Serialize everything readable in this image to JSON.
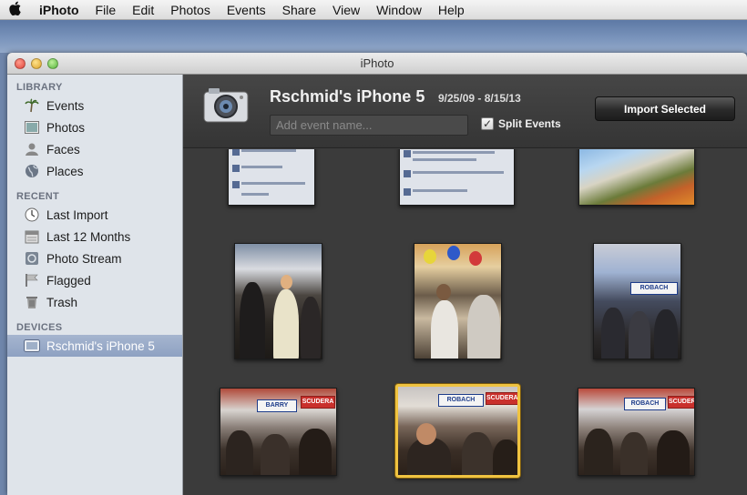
{
  "menubar": {
    "apple_icon": "apple-logo-icon",
    "items": [
      "iPhoto",
      "File",
      "Edit",
      "Photos",
      "Events",
      "Share",
      "View",
      "Window",
      "Help"
    ]
  },
  "window": {
    "title": "iPhoto"
  },
  "sidebar": {
    "library_header": "LIBRARY",
    "library": [
      {
        "label": "Events",
        "icon": "palm-tree-icon"
      },
      {
        "label": "Photos",
        "icon": "photo-icon"
      },
      {
        "label": "Faces",
        "icon": "face-silhouette-icon"
      },
      {
        "label": "Places",
        "icon": "globe-icon"
      }
    ],
    "recent_header": "RECENT",
    "recent": [
      {
        "label": "Last Import",
        "icon": "clock-icon"
      },
      {
        "label": "Last 12 Months",
        "icon": "calendar-icon"
      },
      {
        "label": "Photo Stream",
        "icon": "photo-stream-icon"
      },
      {
        "label": "Flagged",
        "icon": "flag-icon"
      },
      {
        "label": "Trash",
        "icon": "trash-icon"
      }
    ],
    "devices_header": "DEVICES",
    "devices": [
      {
        "label": "Rschmid's iPhone 5",
        "icon": "iphone-device-icon",
        "selected": true
      }
    ]
  },
  "import_header": {
    "device_name": "Rschmid's iPhone 5",
    "date_range": "9/25/09 - 8/15/13",
    "event_name_placeholder": "Add event name...",
    "split_events_label": "Split Events",
    "split_events_checked": true,
    "import_button": "Import Selected"
  },
  "signs": {
    "robach": "ROBACH",
    "scudera": "SCUDERA",
    "barry": "BARRY"
  },
  "colors": {
    "selection_border": "#f0c340",
    "sidebar_bg": "#dfe4ea",
    "main_bg": "#3b3b3b"
  }
}
